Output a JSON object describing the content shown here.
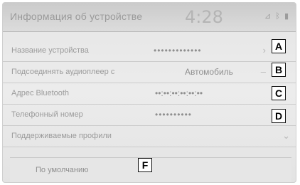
{
  "header": {
    "title": "Информация об устройстве",
    "clock": "4:28",
    "status_icons": [
      "signal-icon",
      "bluetooth-icon",
      "battery-icon"
    ]
  },
  "rows": [
    {
      "label": "Название устройства",
      "value": "•••••••••••••",
      "tag": "A"
    },
    {
      "label": "Подсоединять аудиоплеер с",
      "value": "Автомобиль",
      "tag": "B"
    },
    {
      "label": "Адрес Bluetooth",
      "value": "••:••:••:••:••:••",
      "tag": "C"
    },
    {
      "label": "Телефонный номер",
      "value": "••••••••••",
      "tag": "D"
    },
    {
      "label": "Поддерживаемые профили"
    }
  ],
  "default_button": {
    "label": "По умолчанию",
    "tag": "F"
  },
  "colors": {
    "background": "#ececec",
    "text": "#9b9b9b",
    "tag_border": "#111111"
  }
}
